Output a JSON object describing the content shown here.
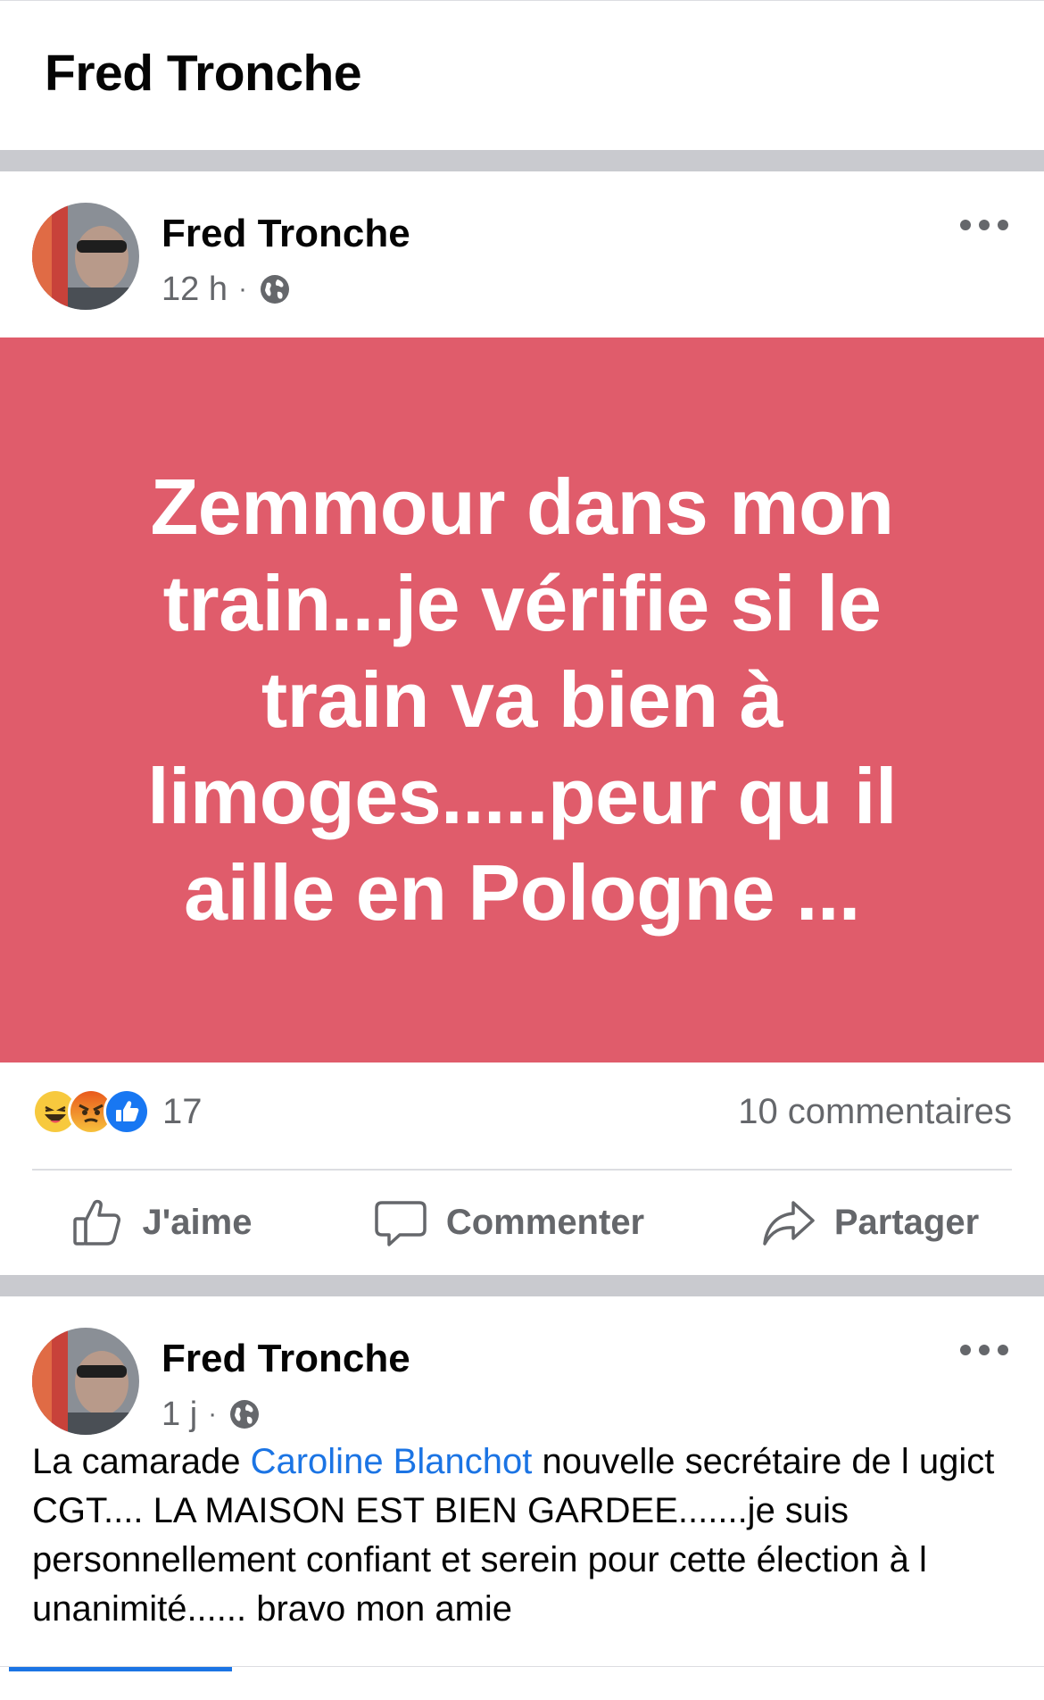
{
  "header": {
    "title": "Fred Tronche"
  },
  "post1": {
    "author": "Fred Tronche",
    "time": "12 h",
    "dot": "·",
    "privacy_icon": "globe-icon",
    "banner_text": "Zemmour dans mon train...je vérifie si le train va bien à limoges.....peur qu il aille en Pologne ...",
    "banner_color": "#e05c6b",
    "reactions": [
      "haha-icon",
      "angry-icon",
      "like-icon"
    ],
    "reaction_count": "17",
    "comments": "10 commentaires",
    "actions": {
      "like": "J'aime",
      "comment": "Commenter",
      "share": "Partager"
    }
  },
  "post2": {
    "author": "Fred Tronche",
    "time": "1 j",
    "dot": "·",
    "privacy_icon": "globe-icon",
    "text_before": "La camarade ",
    "mention": "Caroline Blanchot",
    "text_after": " nouvelle secrétaire de l ugict CGT.... LA MAISON EST BIEN GARDEE.......je suis personnellement confiant et serein pour cette élection  à  l unanimité...... bravo mon amie"
  },
  "colors": {
    "accent": "#1b74e4",
    "text_secondary": "#65676b",
    "separator": "#c9cacf"
  }
}
